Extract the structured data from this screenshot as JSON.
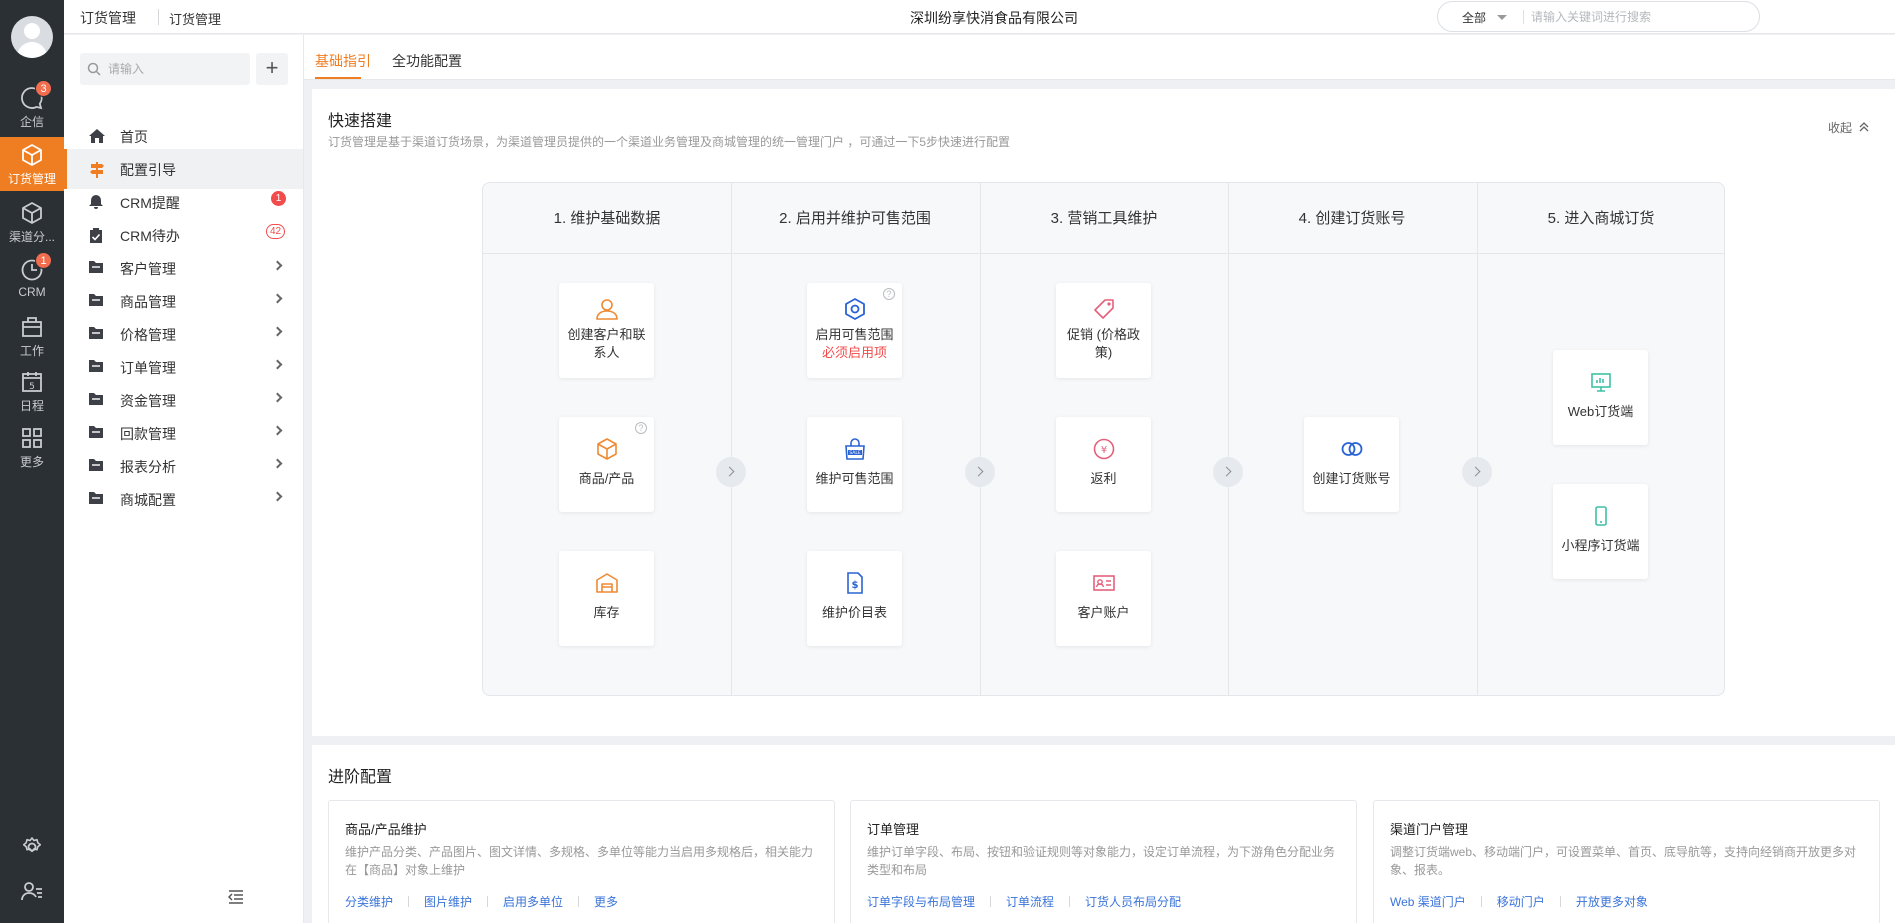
{
  "rail": {
    "items": [
      {
        "label": "企信",
        "badge": "3"
      },
      {
        "label": "订货管理"
      },
      {
        "label": "渠道分..."
      },
      {
        "label": "CRM",
        "badge": "1"
      },
      {
        "label": "工作"
      },
      {
        "label": "日程",
        "icon_text": "5"
      },
      {
        "label": "更多"
      }
    ]
  },
  "topbar": {
    "breadcrumb_app": "订货管理",
    "breadcrumb_page": "订货管理",
    "company": "深圳纷享快消食品有限公司",
    "search_scope": "全部",
    "search_placeholder": "请输入关键词进行搜索"
  },
  "sidebar": {
    "search_placeholder": "请输入",
    "add_label": "+",
    "items": [
      {
        "label": "首页"
      },
      {
        "label": "配置引导"
      },
      {
        "label": "CRM提醒",
        "badge": "1"
      },
      {
        "label": "CRM待办",
        "badge": "42"
      },
      {
        "label": "客户管理"
      },
      {
        "label": "商品管理"
      },
      {
        "label": "价格管理"
      },
      {
        "label": "订单管理"
      },
      {
        "label": "资金管理"
      },
      {
        "label": "回款管理"
      },
      {
        "label": "报表分析"
      },
      {
        "label": "商城配置"
      }
    ]
  },
  "tabs": [
    {
      "label": "基础指引"
    },
    {
      "label": "全功能配置"
    }
  ],
  "quick": {
    "title": "快速搭建",
    "desc": "订货管理是基于渠道订货场景，为渠道管理员提供的一个渠道业务管理及商城管理的统一管理门户 ，可通过一下5步快速进行配置",
    "collapse_label": "收起",
    "steps": [
      {
        "title": "1. 维护基础数据",
        "cards": [
          {
            "label": "创建客户和联系人"
          },
          {
            "label": "商品/产品",
            "help": "?"
          },
          {
            "label": "库存"
          }
        ]
      },
      {
        "title": "2. 启用并维护可售范围",
        "cards": [
          {
            "label": "启用可售范围",
            "required": "必须启用项",
            "help": "?"
          },
          {
            "label": "维护可售范围"
          },
          {
            "label": "维护价目表"
          }
        ]
      },
      {
        "title": "3. 营销工具维护",
        "cards": [
          {
            "label": "促销 (价格政策)"
          },
          {
            "label": "返利"
          },
          {
            "label": "客户账户"
          }
        ]
      },
      {
        "title": "4. 创建订货账号",
        "cards": [
          {
            "label": "创建订货账号"
          }
        ]
      },
      {
        "title": "5. 进入商城订货",
        "cards": [
          {
            "label": "Web订货端"
          },
          {
            "label": "小程序订货端"
          }
        ]
      }
    ]
  },
  "advanced": {
    "title": "进阶配置",
    "cards": [
      {
        "title": "商品/产品维护",
        "desc": "维护产品分类、产品图片、图文详情、多规格、多单位等能力当启用多规格后，相关能力在【商品】对象上维护",
        "links": [
          "分类维护",
          "图片维护",
          "启用多单位",
          "更多"
        ]
      },
      {
        "title": "订单管理",
        "desc": "维护订单字段、布局、按钮和验证规则等对象能力，设定订单流程，为下游角色分配业务类型和布局",
        "links": [
          "订单字段与布局管理",
          "订单流程",
          "订货人员布局分配"
        ]
      },
      {
        "title": "渠道门户管理",
        "desc": "调整订货端web、移动端门户，可设置菜单、首页、底导航等，支持向经销商开放更多对象、报表。",
        "links": [
          "Web 渠道门户",
          "移动门户",
          "开放更多对象"
        ]
      }
    ]
  },
  "colors": {
    "accent": "#ef7d22",
    "rail_bg": "#2b3035",
    "link": "#3a74d8",
    "danger": "#f24b4b"
  }
}
